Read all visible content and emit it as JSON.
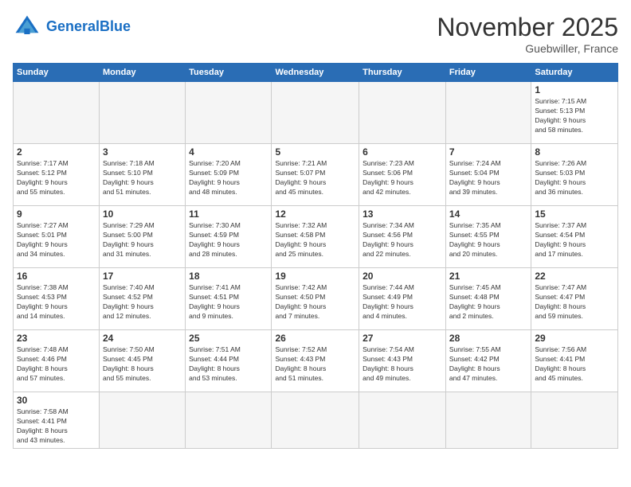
{
  "header": {
    "logo_general": "General",
    "logo_blue": "Blue",
    "month_title": "November 2025",
    "location": "Guebwiller, France"
  },
  "days_of_week": [
    "Sunday",
    "Monday",
    "Tuesday",
    "Wednesday",
    "Thursday",
    "Friday",
    "Saturday"
  ],
  "weeks": [
    [
      {
        "day": "",
        "info": ""
      },
      {
        "day": "",
        "info": ""
      },
      {
        "day": "",
        "info": ""
      },
      {
        "day": "",
        "info": ""
      },
      {
        "day": "",
        "info": ""
      },
      {
        "day": "",
        "info": ""
      },
      {
        "day": "1",
        "info": "Sunrise: 7:15 AM\nSunset: 5:13 PM\nDaylight: 9 hours\nand 58 minutes."
      }
    ],
    [
      {
        "day": "2",
        "info": "Sunrise: 7:17 AM\nSunset: 5:12 PM\nDaylight: 9 hours\nand 55 minutes."
      },
      {
        "day": "3",
        "info": "Sunrise: 7:18 AM\nSunset: 5:10 PM\nDaylight: 9 hours\nand 51 minutes."
      },
      {
        "day": "4",
        "info": "Sunrise: 7:20 AM\nSunset: 5:09 PM\nDaylight: 9 hours\nand 48 minutes."
      },
      {
        "day": "5",
        "info": "Sunrise: 7:21 AM\nSunset: 5:07 PM\nDaylight: 9 hours\nand 45 minutes."
      },
      {
        "day": "6",
        "info": "Sunrise: 7:23 AM\nSunset: 5:06 PM\nDaylight: 9 hours\nand 42 minutes."
      },
      {
        "day": "7",
        "info": "Sunrise: 7:24 AM\nSunset: 5:04 PM\nDaylight: 9 hours\nand 39 minutes."
      },
      {
        "day": "8",
        "info": "Sunrise: 7:26 AM\nSunset: 5:03 PM\nDaylight: 9 hours\nand 36 minutes."
      }
    ],
    [
      {
        "day": "9",
        "info": "Sunrise: 7:27 AM\nSunset: 5:01 PM\nDaylight: 9 hours\nand 34 minutes."
      },
      {
        "day": "10",
        "info": "Sunrise: 7:29 AM\nSunset: 5:00 PM\nDaylight: 9 hours\nand 31 minutes."
      },
      {
        "day": "11",
        "info": "Sunrise: 7:30 AM\nSunset: 4:59 PM\nDaylight: 9 hours\nand 28 minutes."
      },
      {
        "day": "12",
        "info": "Sunrise: 7:32 AM\nSunset: 4:58 PM\nDaylight: 9 hours\nand 25 minutes."
      },
      {
        "day": "13",
        "info": "Sunrise: 7:34 AM\nSunset: 4:56 PM\nDaylight: 9 hours\nand 22 minutes."
      },
      {
        "day": "14",
        "info": "Sunrise: 7:35 AM\nSunset: 4:55 PM\nDaylight: 9 hours\nand 20 minutes."
      },
      {
        "day": "15",
        "info": "Sunrise: 7:37 AM\nSunset: 4:54 PM\nDaylight: 9 hours\nand 17 minutes."
      }
    ],
    [
      {
        "day": "16",
        "info": "Sunrise: 7:38 AM\nSunset: 4:53 PM\nDaylight: 9 hours\nand 14 minutes."
      },
      {
        "day": "17",
        "info": "Sunrise: 7:40 AM\nSunset: 4:52 PM\nDaylight: 9 hours\nand 12 minutes."
      },
      {
        "day": "18",
        "info": "Sunrise: 7:41 AM\nSunset: 4:51 PM\nDaylight: 9 hours\nand 9 minutes."
      },
      {
        "day": "19",
        "info": "Sunrise: 7:42 AM\nSunset: 4:50 PM\nDaylight: 9 hours\nand 7 minutes."
      },
      {
        "day": "20",
        "info": "Sunrise: 7:44 AM\nSunset: 4:49 PM\nDaylight: 9 hours\nand 4 minutes."
      },
      {
        "day": "21",
        "info": "Sunrise: 7:45 AM\nSunset: 4:48 PM\nDaylight: 9 hours\nand 2 minutes."
      },
      {
        "day": "22",
        "info": "Sunrise: 7:47 AM\nSunset: 4:47 PM\nDaylight: 8 hours\nand 59 minutes."
      }
    ],
    [
      {
        "day": "23",
        "info": "Sunrise: 7:48 AM\nSunset: 4:46 PM\nDaylight: 8 hours\nand 57 minutes."
      },
      {
        "day": "24",
        "info": "Sunrise: 7:50 AM\nSunset: 4:45 PM\nDaylight: 8 hours\nand 55 minutes."
      },
      {
        "day": "25",
        "info": "Sunrise: 7:51 AM\nSunset: 4:44 PM\nDaylight: 8 hours\nand 53 minutes."
      },
      {
        "day": "26",
        "info": "Sunrise: 7:52 AM\nSunset: 4:43 PM\nDaylight: 8 hours\nand 51 minutes."
      },
      {
        "day": "27",
        "info": "Sunrise: 7:54 AM\nSunset: 4:43 PM\nDaylight: 8 hours\nand 49 minutes."
      },
      {
        "day": "28",
        "info": "Sunrise: 7:55 AM\nSunset: 4:42 PM\nDaylight: 8 hours\nand 47 minutes."
      },
      {
        "day": "29",
        "info": "Sunrise: 7:56 AM\nSunset: 4:41 PM\nDaylight: 8 hours\nand 45 minutes."
      }
    ],
    [
      {
        "day": "30",
        "info": "Sunrise: 7:58 AM\nSunset: 4:41 PM\nDaylight: 8 hours\nand 43 minutes."
      },
      {
        "day": "",
        "info": ""
      },
      {
        "day": "",
        "info": ""
      },
      {
        "day": "",
        "info": ""
      },
      {
        "day": "",
        "info": ""
      },
      {
        "day": "",
        "info": ""
      },
      {
        "day": "",
        "info": ""
      }
    ]
  ]
}
